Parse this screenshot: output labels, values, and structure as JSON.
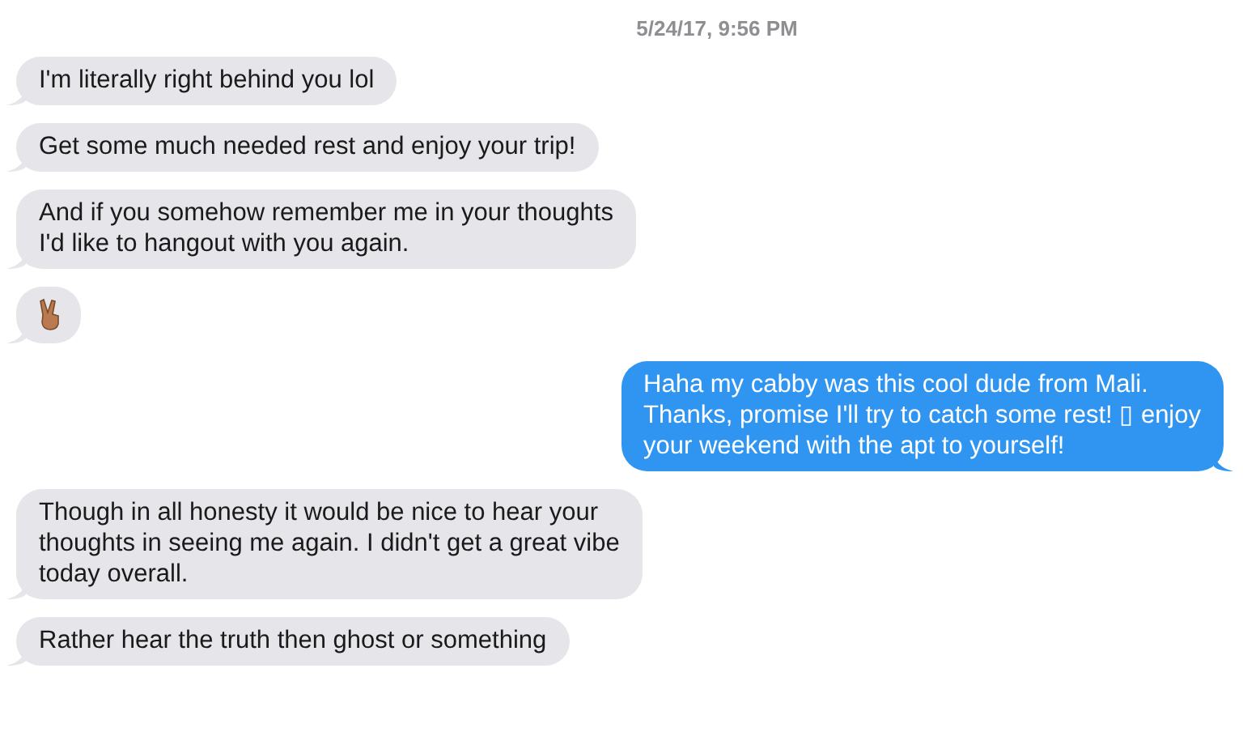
{
  "timestamp": "5/24/17, 9:56 PM",
  "messages": [
    {
      "kind": "text",
      "sent": false,
      "text": "I'm literally right behind you lol"
    },
    {
      "kind": "text",
      "sent": false,
      "text": "Get some much needed rest and enjoy your trip!"
    },
    {
      "kind": "text",
      "sent": false,
      "text": "And if you somehow remember me in your thoughts\nI'd like to hangout with you again."
    },
    {
      "kind": "emoji",
      "sent": false
    },
    {
      "kind": "text",
      "sent": true,
      "text": "Haha my cabby was this cool dude from Mali.\nThanks, promise I'll try to catch some rest! ▯ enjoy\nyour weekend with the apt to yourself!"
    },
    {
      "kind": "text",
      "sent": false,
      "text": "Though in all honesty it would be nice to hear your\nthoughts in seeing me again. I didn't get a great vibe\ntoday overall."
    },
    {
      "kind": "text",
      "sent": false,
      "text": "Rather hear the truth then ghost or something"
    }
  ]
}
